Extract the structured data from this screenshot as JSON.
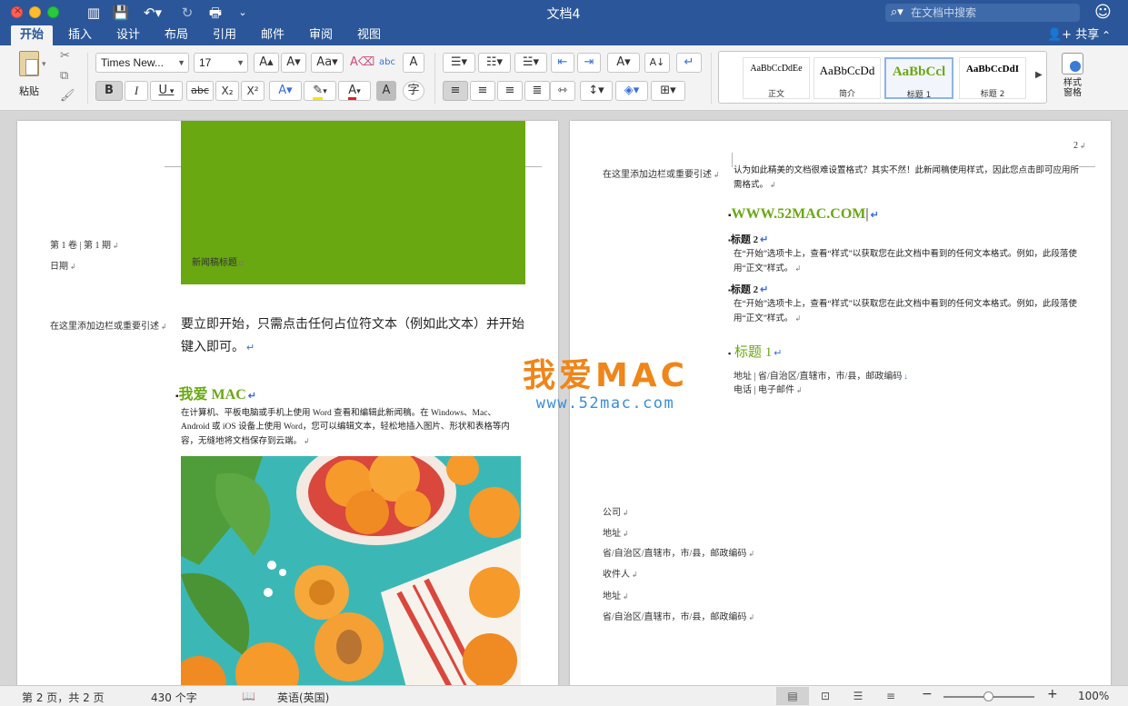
{
  "window": {
    "title": "文档4"
  },
  "search": {
    "placeholder": "在文档中搜索",
    "icon": "search-icon"
  },
  "tabs": [
    {
      "label": "开始",
      "active": true
    },
    {
      "label": "插入"
    },
    {
      "label": "设计"
    },
    {
      "label": "布局"
    },
    {
      "label": "引用"
    },
    {
      "label": "邮件"
    },
    {
      "label": "审阅"
    },
    {
      "label": "视图"
    }
  ],
  "share_label": "共享",
  "ribbon": {
    "paste_label": "粘贴",
    "font_name": "Times New...",
    "font_size": "17",
    "bold": "B",
    "italic": "I",
    "underline": "U",
    "strike": "abc",
    "subscript": "X₂",
    "superscript": "X²",
    "phonetic": "字",
    "char_shade": "A",
    "styles": [
      {
        "sample": "AaBbCcDdEe",
        "name": "正文"
      },
      {
        "sample": "AaBbCcDd",
        "name": "简介"
      },
      {
        "sample": "AaBbCcl",
        "name": "标题 1",
        "selected": true
      },
      {
        "sample": "AaBbCcDdI",
        "name": "标题 2"
      }
    ],
    "style_pane_line1": "样式",
    "style_pane_line2": "窗格"
  },
  "page1": {
    "volume": "第 1 卷 | 第 1 期",
    "date": "日期",
    "banner_title": "新闻稿标题",
    "sidebar_quote": "在这里添加边栏或重要引述",
    "intro": "要立即开始，只需点击任何占位符文本（例如此文本）并开始键入即可。",
    "heading": "我爱 MAC",
    "body": "在计算机、平板电脑或手机上使用 Word 查看和编辑此新闻稿。在 Windows、Mac、Android 或 iOS 设备上使用 Word，您可以编辑文本，轻松地插入图片、形状和表格等内容，无缝地将文档保存到云端。"
  },
  "page2": {
    "page_number": "2",
    "sidebar_quote": "在这里添加边栏或重要引述",
    "intro": "认为如此精美的文档很难设置格式？其实不然！此新闻稿使用样式，因此您点击即可应用所需格式。",
    "site_heading": "WWW.52MAC.COM",
    "h2a": "标题 2",
    "body_a": "在“开始”选项卡上，查看“样式”以获取您在此文档中看到的任何文本格式。例如，此段落使用“正文”样式。",
    "h2b": "标题 2",
    "body_b": "在“开始”选项卡上，查看“样式”以获取您在此文档中看到的任何文本格式。例如，此段落使用“正文”样式。",
    "h1": "标题 1",
    "address_line": "地址 | 省/自治区/直辖市，市/县，邮政编码",
    "phone_line": "电话 | 电子邮件",
    "mail": [
      "公司",
      "地址",
      "省/自治区/直辖市，市/县，邮政编码",
      "收件人",
      "地址",
      "省/自治区/直辖市，市/县，邮政编码"
    ]
  },
  "watermark": {
    "top": "我爱MAC",
    "bottom": "www.52mac.com"
  },
  "status": {
    "page_info": "第 2 页，共 2 页",
    "word_count": "430 个字",
    "language": "英语(英国)",
    "zoom": "100%",
    "zoom_level_percent": 100
  },
  "colors": {
    "brand": "#2b579a",
    "accent_green": "#6aa812",
    "watermark_orange": "#f08519",
    "watermark_blue": "#3a8ed8"
  }
}
